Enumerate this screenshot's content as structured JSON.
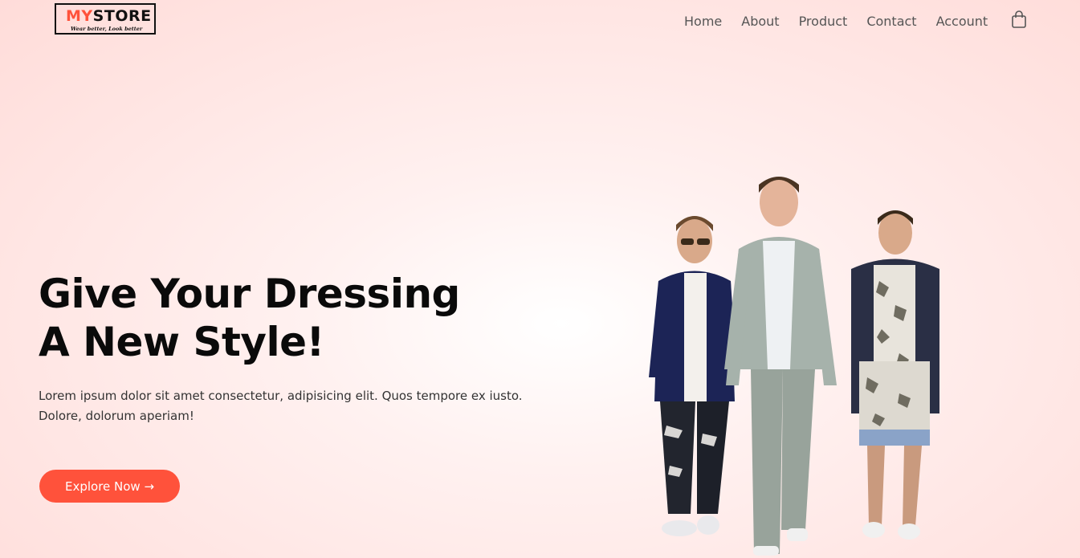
{
  "logo": {
    "brand_part1": "MY",
    "brand_part2": "STORE",
    "tagline": "Wear better, Look better"
  },
  "nav": {
    "items": [
      "Home",
      "About",
      "Product",
      "Contact",
      "Account"
    ],
    "cart_icon": "shopping-bag-icon"
  },
  "hero": {
    "title_line1": "Give Your Dressing",
    "title_line2": "A New Style!",
    "text_line1": "Lorem ipsum dolor sit amet consectetur, adipisicing elit. Quos tempore ex iusto.",
    "text_line2": "Dolore, dolorum aperiam!",
    "cta_label": "Explore Now →"
  },
  "colors": {
    "accent": "#ff523b",
    "background": "#ffdcd9",
    "text_dark": "#0a0a0a"
  }
}
